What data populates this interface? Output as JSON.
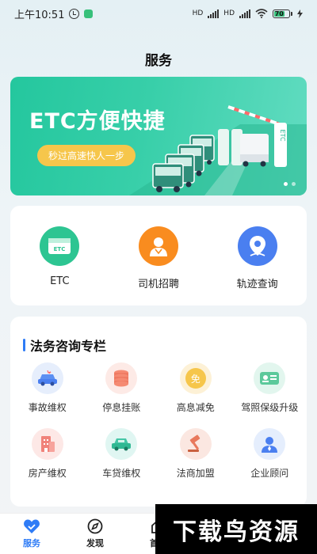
{
  "status_bar": {
    "time": "上午10:51",
    "battery": "70"
  },
  "page": {
    "title": "服务"
  },
  "banner": {
    "title": "ETC方便快捷",
    "subtitle": "秒过高速快人一步",
    "sign_text": "ETC",
    "page_count": 2,
    "active_page": 1
  },
  "quick_actions": [
    {
      "label": "ETC",
      "icon": "etc-card-icon",
      "color": "#2dc592"
    },
    {
      "label": "司机招聘",
      "icon": "driver-icon",
      "color": "#f98c1f"
    },
    {
      "label": "轨迹查询",
      "icon": "location-pin-icon",
      "color": "#4a7ff0"
    }
  ],
  "legal": {
    "title": "法务咨询专栏",
    "accent": "#2f7cf6",
    "items": [
      {
        "label": "事故维权",
        "icon": "car-accident-icon"
      },
      {
        "label": "停息挂账",
        "icon": "coins-icon"
      },
      {
        "label": "高息减免",
        "icon": "waiver-icon",
        "badge": "免"
      },
      {
        "label": "驾照保级升级",
        "icon": "license-icon"
      },
      {
        "label": "房产维权",
        "icon": "building-icon"
      },
      {
        "label": "车贷维权",
        "icon": "car-loan-icon"
      },
      {
        "label": "法商加盟",
        "icon": "gavel-icon"
      },
      {
        "label": "企业顾问",
        "icon": "advisor-icon"
      }
    ]
  },
  "bottom_nav": [
    {
      "label": "服务",
      "icon": "heart-icon",
      "active": true
    },
    {
      "label": "发现",
      "icon": "compass-icon",
      "active": false
    },
    {
      "label": "首页",
      "icon": "home-icon",
      "active": false
    }
  ],
  "watermark": {
    "text": "下载鸟资源"
  }
}
